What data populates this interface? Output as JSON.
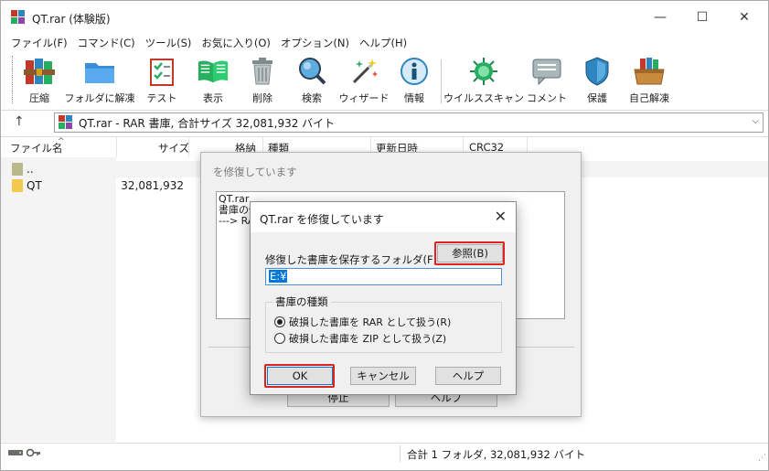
{
  "window": {
    "title": "QT.rar (体験版)",
    "controls": {
      "minimize": "—",
      "maximize": "☐",
      "close": "✕"
    }
  },
  "menu": [
    "ファイル(F)",
    "コマンド(C)",
    "ツール(S)",
    "お気に入り(O)",
    "オプション(N)",
    "ヘルプ(H)"
  ],
  "toolbar": [
    {
      "label": "圧縮",
      "icon": "archive-books-icon"
    },
    {
      "label": "フォルダに解凍",
      "icon": "folder-extract-icon"
    },
    {
      "label": "テスト",
      "icon": "checklist-icon"
    },
    {
      "label": "表示",
      "icon": "book-icon"
    },
    {
      "label": "削除",
      "icon": "trash-icon"
    },
    {
      "label": "検索",
      "icon": "magnifier-icon"
    },
    {
      "label": "ウィザード",
      "icon": "magic-wand-icon"
    },
    {
      "label": "情報",
      "icon": "info-icon"
    },
    {
      "label": "ウイルススキャン",
      "icon": "virus-scan-icon"
    },
    {
      "label": "コメント",
      "icon": "comment-icon"
    },
    {
      "label": "保護",
      "icon": "shield-icon"
    },
    {
      "label": "自己解凍",
      "icon": "sfx-box-icon"
    }
  ],
  "address": {
    "text": "QT.rar - RAR 書庫, 合計サイズ 32,081,932 バイト"
  },
  "columns": {
    "name": "ファイル名",
    "size": "サイズ",
    "packed": "格納",
    "type": "種類",
    "modified": "更新日時",
    "crc": "CRC32"
  },
  "rows": [
    {
      "name": "..",
      "size": ""
    },
    {
      "name": "QT",
      "size": "32,081,932"
    }
  ],
  "status": {
    "text": "合計 1 フォルダ, 32,081,932 バイト"
  },
  "bg_dialog": {
    "title": "を修復しています",
    "log": [
      "QT.rar",
      "書庫の修",
      "---> RA"
    ],
    "stop_label": "停止",
    "help_label": "ヘルプ"
  },
  "dialog": {
    "title": "QT.rar を修復しています",
    "folder_label": "修復した書庫を保存するフォルダ(F)",
    "browse_label": "参照(B)",
    "path_value": "E:¥",
    "group_label": "書庫の種類",
    "option_rar": "破損した書庫を RAR として扱う(R)",
    "option_zip": "破損した書庫を ZIP として扱う(Z)",
    "selected_option": "rar",
    "ok_label": "OK",
    "cancel_label": "キャンセル",
    "help_label": "ヘルプ"
  },
  "colors": {
    "highlight": "#e0221c",
    "selection": "#0078d7",
    "folder": "#f2c94c"
  }
}
